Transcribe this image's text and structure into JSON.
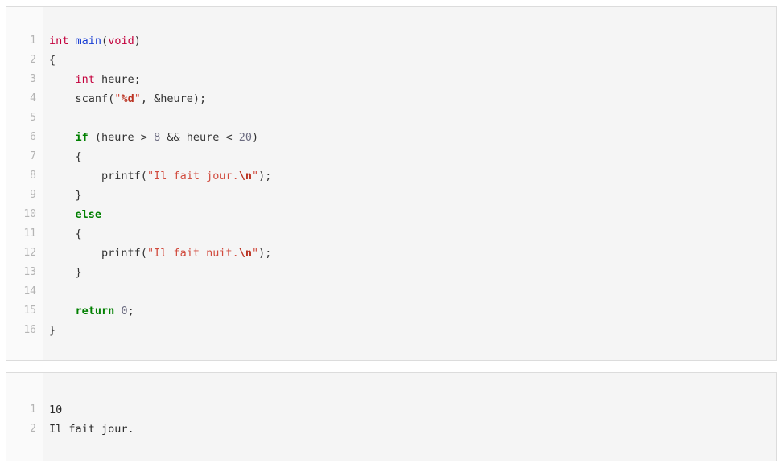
{
  "editor": {
    "language": "c",
    "line_numbers": [
      "1",
      "2",
      "3",
      "4",
      "5",
      "6",
      "7",
      "8",
      "9",
      "10",
      "11",
      "12",
      "13",
      "14",
      "15",
      "16"
    ],
    "lines": [
      {
        "n": "1",
        "plain": "int main(void)"
      },
      {
        "n": "2",
        "plain": "{"
      },
      {
        "n": "3",
        "plain": "    int heure;"
      },
      {
        "n": "4",
        "plain": "    scanf(\"%d\", &heure);"
      },
      {
        "n": "5",
        "plain": ""
      },
      {
        "n": "6",
        "plain": "    if (heure > 8 && heure < 20)"
      },
      {
        "n": "7",
        "plain": "    {"
      },
      {
        "n": "8",
        "plain": "        printf(\"Il fait jour.\\n\");"
      },
      {
        "n": "9",
        "plain": "    }"
      },
      {
        "n": "10",
        "plain": "    else"
      },
      {
        "n": "11",
        "plain": "    {"
      },
      {
        "n": "12",
        "plain": "        printf(\"Il fait nuit.\\n\");"
      },
      {
        "n": "13",
        "plain": "    }"
      },
      {
        "n": "14",
        "plain": ""
      },
      {
        "n": "15",
        "plain": "    return 0;"
      },
      {
        "n": "16",
        "plain": "}"
      }
    ],
    "tokens": {
      "l1_int": "int",
      "l1_sp": " ",
      "l1_main": "main",
      "l1_open": "(",
      "l1_void": "void",
      "l1_close": ")",
      "l2_brace": "{",
      "l3_indent": "    ",
      "l3_int": "int",
      "l3_rest": " heure;",
      "l4_indent": "    ",
      "l4_scanf": "scanf(",
      "l4_quote1": "\"",
      "l4_fmt": "%d",
      "l4_quote2": "\"",
      "l4_rest": ", &heure);",
      "l6_indent": "    ",
      "l6_if": "if",
      "l6_a": " (heure > ",
      "l6_n8": "8",
      "l6_b": " && heure < ",
      "l6_n20": "20",
      "l6_c": ")",
      "l7_brace": "    {",
      "l8_indent": "        ",
      "l8_printf": "printf(",
      "l8_quote1": "\"",
      "l8_text": "Il fait jour.",
      "l8_esc": "\\n",
      "l8_quote2": "\"",
      "l8_rest": ");",
      "l9_brace": "    }",
      "l10_indent": "    ",
      "l10_else": "else",
      "l11_brace": "    {",
      "l12_indent": "        ",
      "l12_printf": "printf(",
      "l12_quote1": "\"",
      "l12_text": "Il fait nuit.",
      "l12_esc": "\\n",
      "l12_quote2": "\"",
      "l12_rest": ");",
      "l13_brace": "    }",
      "l15_indent": "    ",
      "l15_return": "return",
      "l15_sp": " ",
      "l15_zero": "0",
      "l15_semi": ";",
      "l16_brace": "}"
    }
  },
  "output": {
    "line_numbers": [
      "1",
      "2"
    ],
    "lines": [
      "10",
      "Il fait jour."
    ]
  },
  "colors": {
    "page_background": "#ffffff",
    "panel_background": "#f5f5f5",
    "gutter_background": "#fafafa",
    "panel_border": "#dcdcdc",
    "line_number": "#b4b4b4",
    "text": "#333333",
    "type_keyword": "#c4003c",
    "function_name": "#1a3fd4",
    "control_keyword": "#008000",
    "string": "#d14b3e",
    "escape": "#bb3322",
    "number": "#6b6b80"
  }
}
